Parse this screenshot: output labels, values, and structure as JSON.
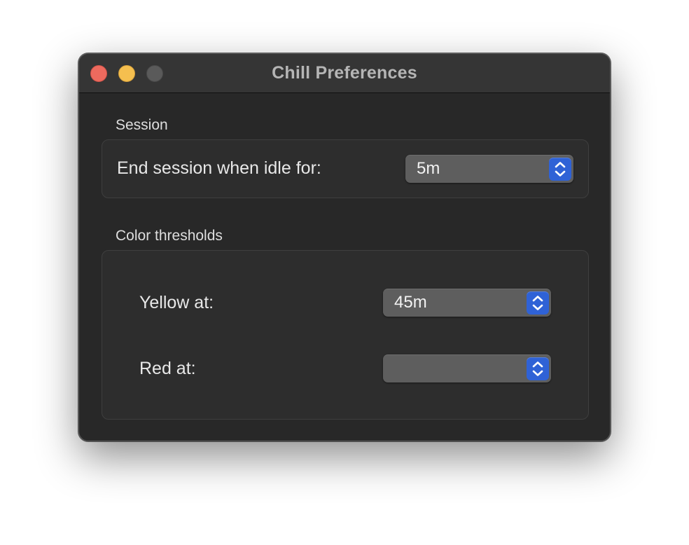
{
  "window": {
    "title": "Chill Preferences"
  },
  "session": {
    "section_label": "Session",
    "idle_label": "End session when idle for:",
    "idle_value": "5m"
  },
  "thresholds": {
    "section_label": "Color thresholds",
    "yellow_label": "Yellow at:",
    "yellow_value": "45m",
    "red_label": "Red at:",
    "red_value": ""
  },
  "colors": {
    "close_button": "#ed6a5e",
    "minimize_button": "#f5bf4f",
    "zoom_button_disabled": "#5a5a5a",
    "popup_accent": "#2f62d6",
    "window_background": "#282828"
  },
  "icons": {
    "popup_arrows": "chevron-up-down-icon"
  }
}
